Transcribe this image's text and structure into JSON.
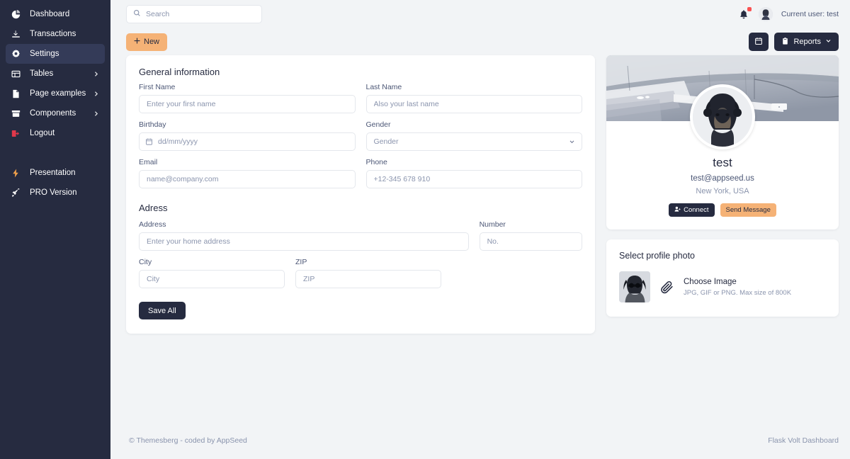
{
  "sidebar": {
    "items": [
      {
        "label": "Dashboard",
        "icon": "pie-chart-icon",
        "active": false,
        "chevron": false
      },
      {
        "label": "Transactions",
        "icon": "download-icon",
        "active": false,
        "chevron": false
      },
      {
        "label": "Settings",
        "icon": "gear-icon",
        "active": true,
        "chevron": false
      },
      {
        "label": "Tables",
        "icon": "table-icon",
        "active": false,
        "chevron": true
      },
      {
        "label": "Page examples",
        "icon": "document-icon",
        "active": false,
        "chevron": true
      },
      {
        "label": "Components",
        "icon": "archive-icon",
        "active": false,
        "chevron": true
      },
      {
        "label": "Logout",
        "icon": "logout-icon",
        "active": false,
        "chevron": false
      }
    ],
    "secondary": [
      {
        "label": "Presentation",
        "icon": "bolt-icon"
      },
      {
        "label": "PRO Version",
        "icon": "rocket-icon"
      }
    ]
  },
  "topbar": {
    "search_placeholder": "Search",
    "search_value": "",
    "current_user": "Current user: test",
    "notification_badge": true
  },
  "actionbar": {
    "new_label": "New",
    "calendar_label": "",
    "reports_label": "Reports"
  },
  "general": {
    "title": "General information",
    "fields": {
      "first_name_label": "First Name",
      "first_name_placeholder": "Enter your first name",
      "first_name_value": "",
      "last_name_label": "Last Name",
      "last_name_placeholder": "Also your last name",
      "last_name_value": "",
      "birthday_label": "Birthday",
      "birthday_placeholder": "dd/mm/yyyy",
      "birthday_value": "",
      "gender_label": "Gender",
      "gender_value": "Gender",
      "email_label": "Email",
      "email_placeholder": "name@company.com",
      "email_value": "",
      "phone_label": "Phone",
      "phone_placeholder": "+12-345 678 910",
      "phone_value": ""
    }
  },
  "address": {
    "title": "Adress",
    "fields": {
      "address_label": "Address",
      "address_placeholder": "Enter your home address",
      "address_value": "",
      "number_label": "Number",
      "number_placeholder": "No.",
      "number_value": "",
      "city_label": "City",
      "city_placeholder": "City",
      "city_value": "",
      "zip_label": "ZIP",
      "zip_placeholder": "ZIP",
      "zip_value": ""
    },
    "save_label": "Save All"
  },
  "profile": {
    "name": "test",
    "email": "test@appseed.us",
    "location": "New York, USA",
    "connect_label": "Connect",
    "message_label": "Send Message"
  },
  "photo": {
    "title": "Select profile photo",
    "choose_label": "Choose Image",
    "hint": "JPG, GIF or PNG. Max size of 800K"
  },
  "footer": {
    "left": "© Themesberg - coded by AppSeed",
    "right": "Flask Volt Dashboard"
  },
  "colors": {
    "sidebar_bg": "#262b40",
    "accent_orange": "#f5b276",
    "dark": "#262b40",
    "page_bg": "#f2f4f6",
    "logout_red": "#e0384b",
    "badge_red": "#fa5252"
  }
}
